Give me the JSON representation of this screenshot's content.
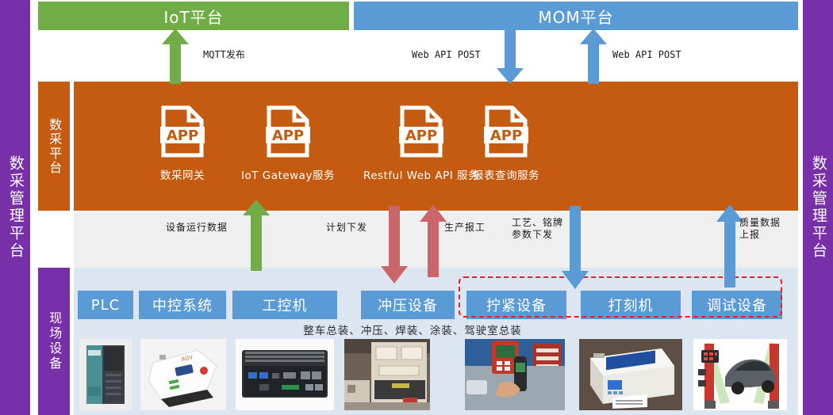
{
  "rails": {
    "left_label": "数采管理平台",
    "right_label": "数采管理平台",
    "color": "#7830A8"
  },
  "top_platforms": [
    {
      "name": "iot-platform",
      "label": "IoT平台",
      "color": "#70AD47"
    },
    {
      "name": "mom-platform",
      "label": "MOM平台",
      "color": "#5B9BD5"
    }
  ],
  "layers": {
    "acquisition": {
      "side_label": "数采平台",
      "color": "#C55A11",
      "services": [
        {
          "icon": "app-document-icon",
          "label": "数采网关"
        },
        {
          "icon": "app-document-icon",
          "label": "IoT Gateway服务"
        },
        {
          "icon": "app-document-icon",
          "label": "Restful Web API 服务"
        },
        {
          "icon": "app-document-icon",
          "label": "报表查询服务"
        }
      ]
    },
    "field": {
      "side_label": "现场设备",
      "color": "#DCE6F1",
      "process_note": "整车总装、冲压、焊装、涂装、驾驶室总装",
      "group_highlight_color": "#EE1C25",
      "devices": [
        {
          "label": "PLC",
          "photo": "plc-module-photo"
        },
        {
          "label": "中控系统",
          "photo": "agv-vehicle-photo"
        },
        {
          "label": "工控机",
          "photo": "industrial-pc-photo"
        },
        {
          "label": "冲压设备",
          "photo": "stamping-press-photo"
        },
        {
          "label": "拧紧设备",
          "photo": "torque-gun-photo"
        },
        {
          "label": "打刻机",
          "photo": "marking-machine-photo"
        },
        {
          "label": "调试设备",
          "photo": "wheel-alignment-photo"
        }
      ]
    }
  },
  "flows": [
    {
      "name": "mqtt-publish",
      "label": "MQTT发布",
      "color": "#70AD47",
      "direction": "up"
    },
    {
      "name": "web-api-post-down",
      "label": "Web API POST",
      "color": "#5B9BD5",
      "direction": "down"
    },
    {
      "name": "web-api-post-up",
      "label": "Web API POST",
      "color": "#5B9BD5",
      "direction": "up"
    },
    {
      "name": "device-runtime-data",
      "label": "设备运行数据",
      "color": "#70AD47",
      "direction": "up"
    },
    {
      "name": "plan-dispatch",
      "label": "计划下发",
      "color": "#C9656B",
      "direction": "down"
    },
    {
      "name": "production-report",
      "label": "生产报工",
      "color": "#C9656B",
      "direction": "up"
    },
    {
      "name": "process-param-push",
      "label": "工艺、铭牌\n参数下发",
      "color": "#5B9BD5",
      "direction": "down",
      "line1": "工艺、铭牌",
      "line2": "参数下发"
    },
    {
      "name": "quality-data-report",
      "label": "质量数据\n上报",
      "color": "#5B9BD5",
      "direction": "up",
      "line1": "质量数据",
      "line2": "上报"
    }
  ]
}
